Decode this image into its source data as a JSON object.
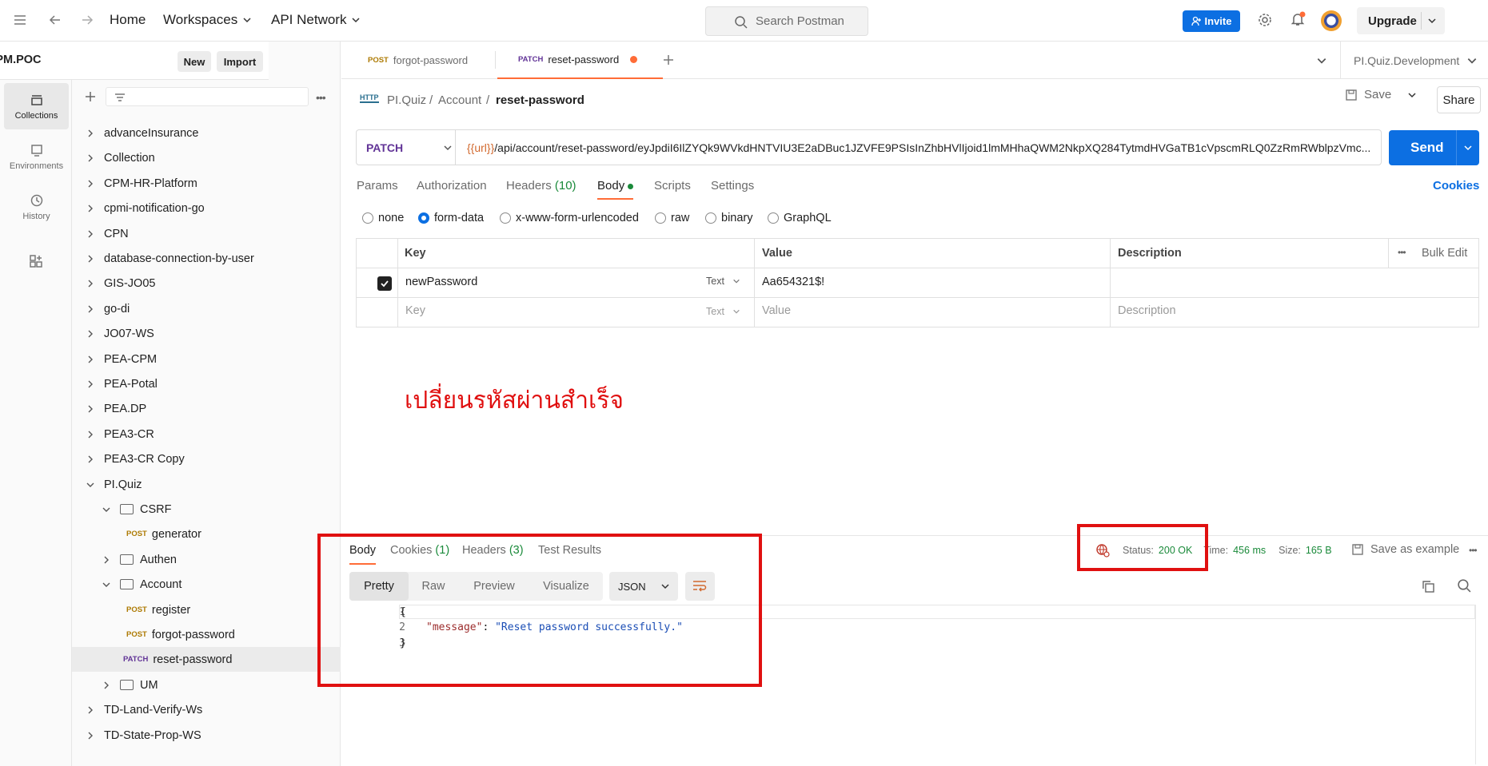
{
  "topbar": {
    "home": "Home",
    "workspaces": "Workspaces",
    "api_network": "API Network",
    "search_placeholder": "Search Postman",
    "invite": "Invite",
    "upgrade": "Upgrade"
  },
  "rail": [
    {
      "label": "Collections",
      "icon": "collections-icon"
    },
    {
      "label": "Environments",
      "icon": "environments-icon"
    },
    {
      "label": "History",
      "icon": "history-icon"
    }
  ],
  "workspace": {
    "name": "PEA.CPM.POC",
    "new_label": "New",
    "import_label": "Import"
  },
  "tree": {
    "collections_top": [
      "advanceInsurance",
      "Collection",
      "CPM-HR-Platform",
      "cpmi-notification-go",
      "CPN",
      "database-connection-by-user",
      "GIS-JO05",
      "go-di",
      "JO07-WS",
      "PEA-CPM",
      "PEA-Potal",
      "PEA.DP",
      "PEA3-CR",
      "PEA3-CR Copy"
    ],
    "open_collection": "PI.Quiz",
    "csrf": "CSRF",
    "csrf_req_method": "POST",
    "csrf_req": "generator",
    "authen": "Authen",
    "account": "Account",
    "account_reqs": [
      {
        "method": "POST",
        "name": "register"
      },
      {
        "method": "POST",
        "name": "forgot-password"
      },
      {
        "method": "PATCH",
        "name": "reset-password"
      }
    ],
    "um": "UM",
    "collections_bottom": [
      "TD-Land-Verify-Ws",
      "TD-State-Prop-WS"
    ]
  },
  "tabs": [
    {
      "method": "POST",
      "name": "forgot-password"
    },
    {
      "method": "PATCH",
      "name": "reset-password"
    }
  ],
  "environment": "PI.Quiz.Development",
  "breadcrumb": {
    "collection": "PI.Quiz",
    "folder": "Account",
    "request": "reset-password",
    "sep": "/"
  },
  "actions": {
    "save": "Save",
    "share": "Share",
    "send": "Send"
  },
  "request": {
    "method": "PATCH",
    "url_var": "{{url}}",
    "url_rest": "/api/account/reset-password/eyJpdiI6IlZYQk9WVkdHNTVIU3E2aDBuc1JZVFE9PSIsInZhbHVlIjoid1lmMHhaQWM2NkpXQ284TytmdHVGaTB1cVpscmRLQ0ZzRmRWblpzVmc..."
  },
  "req_tabs": {
    "params": "Params",
    "authorization": "Authorization",
    "headers": "Headers",
    "headers_count": "(10)",
    "body": "Body",
    "scripts": "Scripts",
    "settings": "Settings",
    "cookies": "Cookies"
  },
  "body_types": [
    "none",
    "form-data",
    "x-www-form-urlencoded",
    "raw",
    "binary",
    "GraphQL"
  ],
  "body_type_selected": "form-data",
  "params_table": {
    "headers": {
      "key": "Key",
      "value": "Value",
      "description": "Description",
      "bulk_edit": "Bulk Edit"
    },
    "rows": [
      {
        "checked": true,
        "key": "newPassword",
        "type": "Text",
        "value": "Aa654321$!",
        "description": ""
      }
    ],
    "placeholder": {
      "key": "Key",
      "type": "Text",
      "value": "Value",
      "description": "Description"
    }
  },
  "annotation_text": "เปลี่ยนรหัสผ่านสำเร็จ",
  "response": {
    "tabs": {
      "body": "Body",
      "cookies": "Cookies",
      "cookies_count": "(1)",
      "headers": "Headers",
      "headers_count": "(3)",
      "test_results": "Test Results"
    },
    "formats": [
      "Pretty",
      "Raw",
      "Preview",
      "Visualize"
    ],
    "format_selected": "Pretty",
    "language": "JSON",
    "status_label": "Status:",
    "status_value": "200 OK",
    "time_label": "Time:",
    "time_value": "456 ms",
    "size_label": "Size:",
    "size_value": "165 B",
    "save_as_example": "Save as example",
    "code_lines": [
      {
        "n": "1",
        "text": "{"
      },
      {
        "n": "2",
        "key": "\"message\"",
        "colon": ": ",
        "val": "\"Reset password successfully.\""
      },
      {
        "n": "3",
        "text": "}"
      }
    ]
  },
  "colors": {
    "accent": "#0c6fe2",
    "highlight": "#e01010",
    "ok": "#1a8a3a",
    "patch": "#623497",
    "post": "#ad7a03"
  }
}
